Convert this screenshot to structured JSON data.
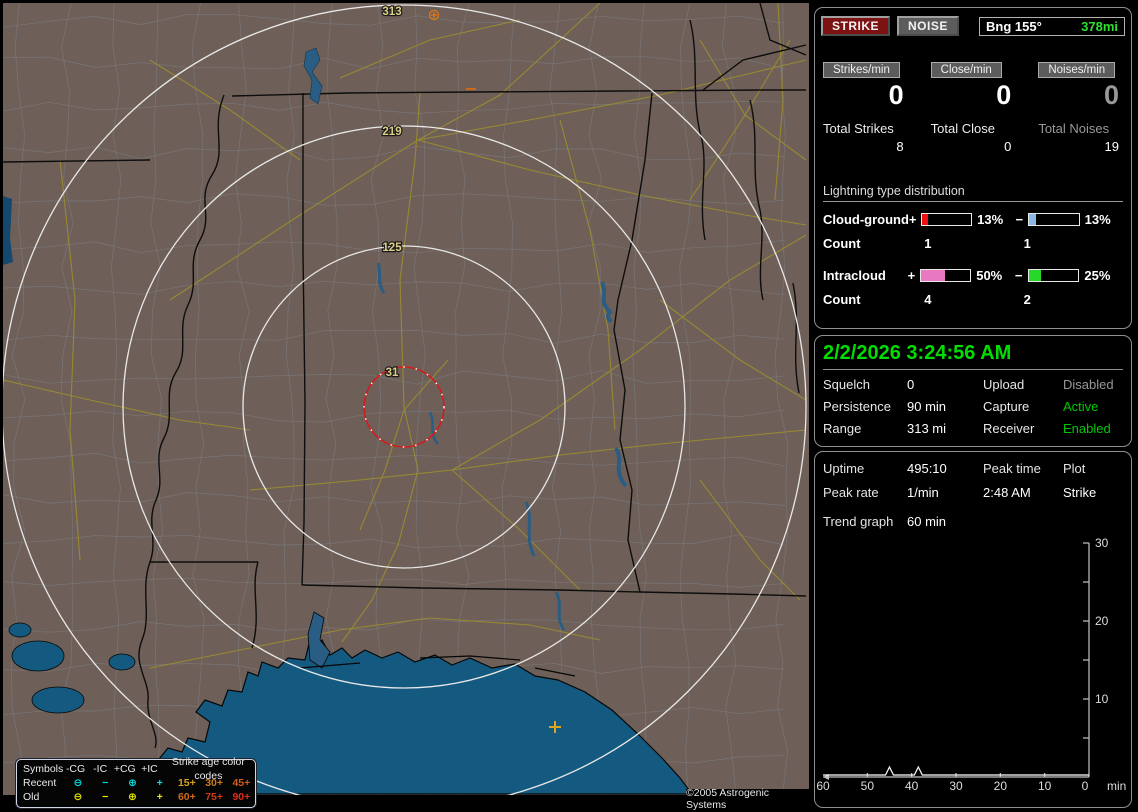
{
  "header": {
    "strike_btn": "STRIKE",
    "noise_btn": "NOISE",
    "bearing_label": "Bng 155°",
    "bearing_distance": "378mi",
    "bearing_distance_color": "#30e030"
  },
  "counters": {
    "columns": [
      {
        "button": "Strikes/min",
        "rate": "0",
        "total_label": "Total Strikes",
        "total": "8"
      },
      {
        "button": "Close/min",
        "rate": "0",
        "total_label": "Total Close",
        "total": "0"
      },
      {
        "button": "Noises/min",
        "rate": "0",
        "total_label": "Total Noises",
        "total": "19"
      }
    ]
  },
  "distribution": {
    "title": "Lightning type distribution",
    "rows": [
      {
        "label": "Cloud-ground",
        "plus_sign": "+",
        "plus_pct": "13%",
        "plus_fill": 13,
        "plus_color": "#ee1010",
        "minus_sign": "−",
        "minus_pct": "13%",
        "minus_fill": 13,
        "minus_color": "#8cb8e8",
        "count_label": "Count",
        "plus_count": "1",
        "minus_count": "1"
      },
      {
        "label": "Intracloud",
        "plus_sign": "+",
        "plus_pct": "50%",
        "plus_fill": 50,
        "plus_color": "#e878c0",
        "minus_sign": "−",
        "minus_pct": "25%",
        "minus_fill": 25,
        "minus_color": "#28d828",
        "count_label": "Count",
        "plus_count": "4",
        "minus_count": "2"
      }
    ]
  },
  "status": {
    "datetime": "2/2/2026 3:24:56 AM",
    "datetime_color": "#00dd00",
    "rows": [
      {
        "l1": "Squelch",
        "v1": "0",
        "l2": "Upload",
        "v2": "Disabled",
        "v2_color": "#989898"
      },
      {
        "l1": "Persistence",
        "v1": "90 min",
        "l2": "Capture",
        "v2": "Active",
        "v2_color": "#00c800"
      },
      {
        "l1": "Range",
        "v1": "313 mi",
        "l2": "Receiver",
        "v2": "Enabled",
        "v2_color": "#00c800"
      }
    ]
  },
  "uptime_panel": {
    "rows": [
      [
        "Uptime",
        "495:10",
        "Peak time",
        "Plot"
      ],
      [
        "Peak rate",
        "1/min",
        "2:48 AM",
        "Strike"
      ]
    ],
    "trend_label": "Trend graph",
    "trend_value": "60 min"
  },
  "trend_chart": {
    "type": "line",
    "x_ticks": [
      "60",
      "50",
      "40",
      "30",
      "20",
      "10",
      "0"
    ],
    "x_unit": "min",
    "y_ticks": [
      "30",
      "20",
      "10"
    ],
    "ylim": [
      0,
      30
    ],
    "xlim_minutes_ago": [
      60,
      0
    ],
    "points": [
      {
        "minutes_ago": 45,
        "value": 1
      },
      {
        "minutes_ago": 38.5,
        "value": 1
      }
    ]
  },
  "map": {
    "ring_labels": [
      "313",
      "219",
      "125",
      "31"
    ],
    "ring_label_color": "#ded08a",
    "range_rings_mi": [
      313,
      219,
      125,
      31
    ],
    "close_ring_color": "#d41c1c",
    "copyright": "©2005 Astrogenic Systems",
    "strike_symbols": [
      {
        "type": "+CG",
        "age": "old",
        "color": "#e07818"
      },
      {
        "type": "-IC",
        "age": "old",
        "color": "#cc6a18"
      },
      {
        "type": "+IC",
        "age": "old",
        "color": "#e0a51e"
      }
    ]
  },
  "legend": {
    "col_headers": [
      "Symbols",
      "-CG",
      "-IC",
      "+CG",
      "+IC"
    ],
    "age_title": "Strike age color codes",
    "rows": [
      {
        "label": "Recent",
        "color": "#00e0e0"
      },
      {
        "label": "Old",
        "color": "#e8e800"
      }
    ],
    "symbols": [
      [
        "⊖",
        "−",
        "⊕",
        "+"
      ],
      [
        "⊖",
        "−",
        "⊕",
        "+"
      ]
    ],
    "ages": [
      {
        "label": "15+",
        "color": "#d8a01d"
      },
      {
        "label": "30+",
        "color": "#cd7a1e"
      },
      {
        "label": "45+",
        "color": "#cd5c1e"
      },
      {
        "label": "60+",
        "color": "#cd6a1a"
      },
      {
        "label": "75+",
        "color": "#cd3a1a"
      },
      {
        "label": "90+",
        "color": "#e32c1a"
      }
    ]
  }
}
